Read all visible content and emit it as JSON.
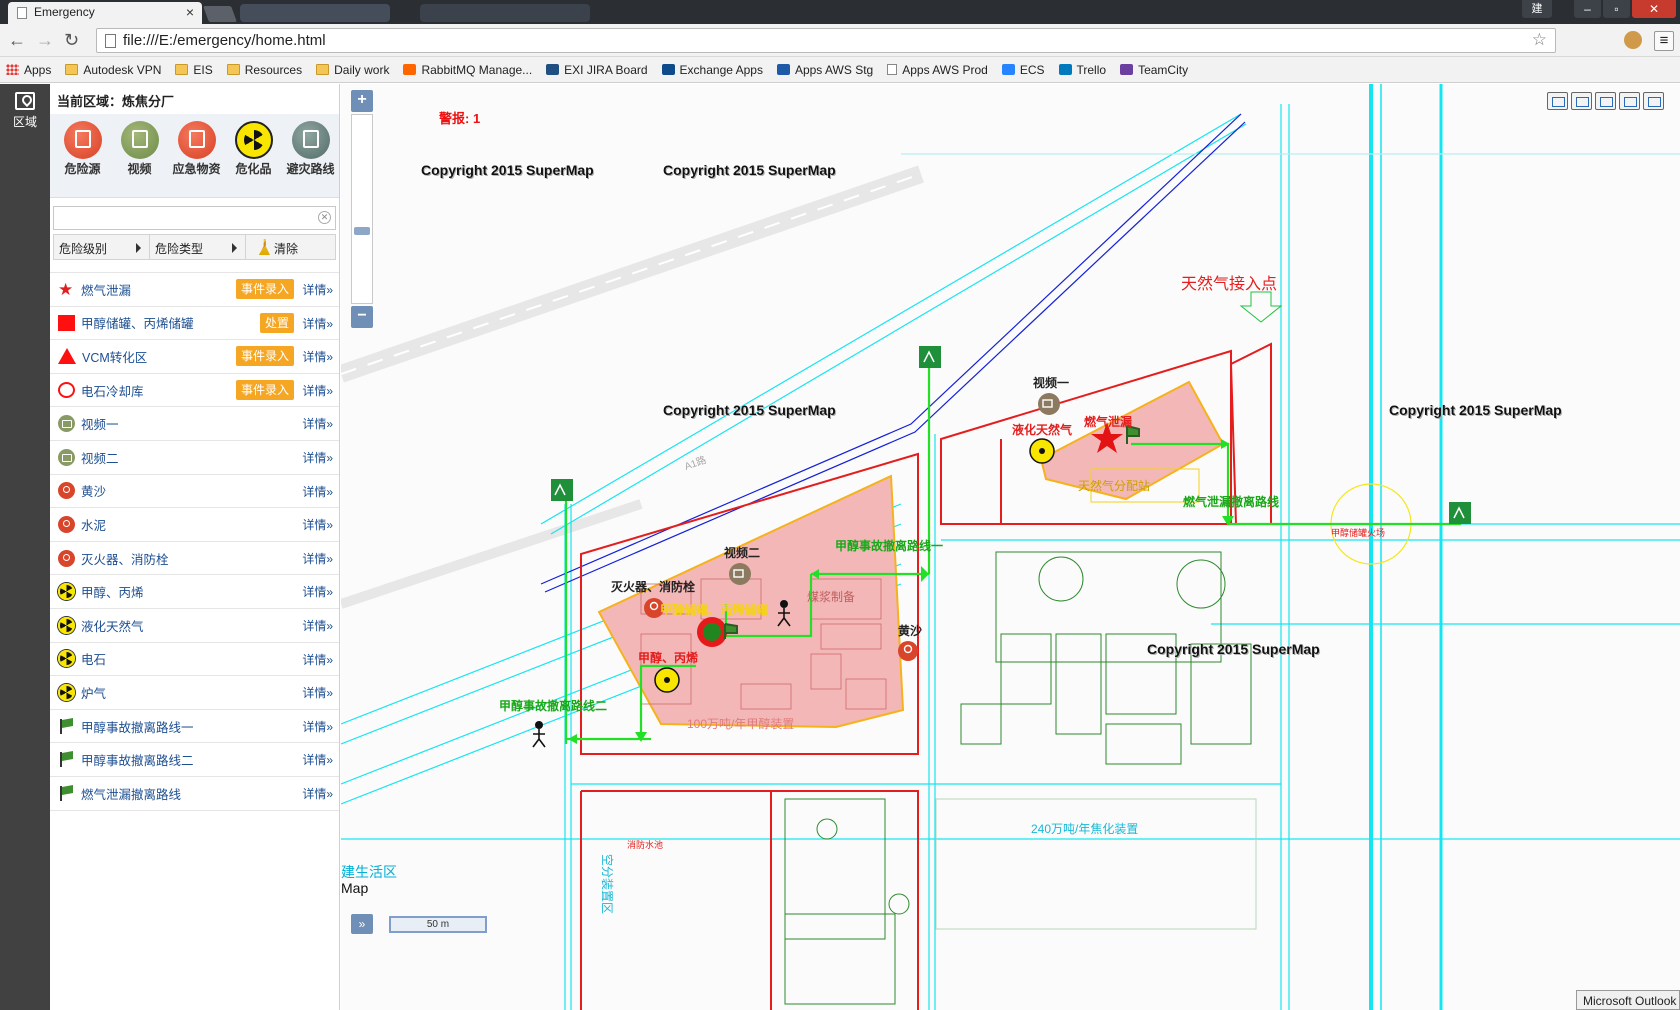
{
  "browser": {
    "tab_title": "Emergency",
    "tab_close": "×",
    "user_badge": "建",
    "window_min": "–",
    "window_max": "▫",
    "window_close": "✕",
    "address": "file:///E:/emergency/home.html",
    "back": "←",
    "forward": "→",
    "reload": "↻",
    "star": "☆",
    "menu": "≡",
    "bookmarks": [
      {
        "label": "Apps",
        "icon": "apps-grid-icon"
      },
      {
        "label": "Autodesk VPN",
        "icon": "folder-icon"
      },
      {
        "label": "EIS",
        "icon": "folder-icon"
      },
      {
        "label": "Resources",
        "icon": "folder-icon"
      },
      {
        "label": "Daily work",
        "icon": "folder-icon"
      },
      {
        "label": "RabbitMQ Manage...",
        "icon": "rabbitmq-icon"
      },
      {
        "label": "EXI JIRA Board",
        "icon": "jira-icon"
      },
      {
        "label": "Exchange Apps",
        "icon": "exchange-icon"
      },
      {
        "label": "Apps AWS Stg",
        "icon": "arrow-up-icon"
      },
      {
        "label": "Apps AWS Prod",
        "icon": "page-icon"
      },
      {
        "label": "ECS",
        "icon": "ecs-icon"
      },
      {
        "label": "Trello",
        "icon": "trello-icon"
      },
      {
        "label": "TeamCity",
        "icon": "teamcity-icon"
      }
    ]
  },
  "rail": {
    "region_label": "区域"
  },
  "panel": {
    "region_prefix": "当前区域：",
    "region_name": "炼焦分厂",
    "categories": [
      {
        "label": "危险源",
        "icon": "hazard-source-icon"
      },
      {
        "label": "视频",
        "icon": "video-icon"
      },
      {
        "label": "应急物资",
        "icon": "supplies-pin-icon"
      },
      {
        "label": "危化品",
        "icon": "radiation-icon"
      },
      {
        "label": "避灾路线",
        "icon": "route-map-icon"
      }
    ],
    "search_placeholder": "",
    "filters": {
      "level": "危险级别",
      "type": "危险类型",
      "clear": "清除"
    },
    "detail_label": "详情»",
    "items": [
      {
        "icon": "star",
        "name": "燃气泄漏",
        "action": "事件录入"
      },
      {
        "icon": "square",
        "name": "甲醇储罐、丙烯储罐",
        "action": "处置"
      },
      {
        "icon": "triangle",
        "name": "VCM转化区",
        "action": "事件录入"
      },
      {
        "icon": "ring",
        "name": "电石冷却库",
        "action": "事件录入"
      },
      {
        "icon": "cam",
        "name": "视频一",
        "action": ""
      },
      {
        "icon": "cam",
        "name": "视频二",
        "action": ""
      },
      {
        "icon": "pin",
        "name": "黄沙",
        "action": ""
      },
      {
        "icon": "pin",
        "name": "水泥",
        "action": ""
      },
      {
        "icon": "pin",
        "name": "灭火器、消防栓",
        "action": ""
      },
      {
        "icon": "rad",
        "name": "甲醇、丙烯",
        "action": ""
      },
      {
        "icon": "rad",
        "name": "液化天然气",
        "action": ""
      },
      {
        "icon": "rad",
        "name": "电石",
        "action": ""
      },
      {
        "icon": "rad",
        "name": "炉气",
        "action": ""
      },
      {
        "icon": "flag",
        "name": "甲醇事故撤离路线一",
        "action": ""
      },
      {
        "icon": "flag",
        "name": "甲醇事故撤离路线二",
        "action": ""
      },
      {
        "icon": "flag",
        "name": "燃气泄漏撤离路线",
        "action": ""
      }
    ]
  },
  "map": {
    "zoom_in": "+",
    "zoom_out": "−",
    "alarm": "警报: 1",
    "copyright": "Copyright 2015 SuperMap",
    "expand": "»",
    "scale": "50 m",
    "left_edge_1": "建生活区",
    "left_edge_2": "Map",
    "labels": {
      "gas_entry": "天然气接入点",
      "video1": "视频一",
      "lng": "液化天然气",
      "gas_leak": "燃气泄漏",
      "gas_station": "天然气分配站",
      "gas_route": "燃气泄漏撤离路线",
      "video2": "视频二",
      "extinguisher": "灭火器、消防栓",
      "tanks": "甲醇储罐、丙烯储罐",
      "methanol": "甲醇、丙烯",
      "coal": "煤浆制备",
      "route1": "甲醇事故撤离路线一",
      "route2": "甲醇事故撤离路线二",
      "sand": "黄沙",
      "methanol_plant": "100万吨/年甲醇装置",
      "coking": "240万吨/年焦化装置",
      "air_sep": "空分装置区",
      "fire_pool": "消防水池",
      "a1": "A1路",
      "cold_zone": "甲醇储罐火场"
    },
    "colors": {
      "danger_fill": "#f3b7b7",
      "danger_outline": "#f5b21a",
      "route": "#22e026",
      "cad_cyan": "#15e5f0",
      "boundary_red": "#e41e1e",
      "cad_green": "#2d8a2d"
    }
  },
  "taskbar": {
    "outlook": "Microsoft Outlook"
  }
}
